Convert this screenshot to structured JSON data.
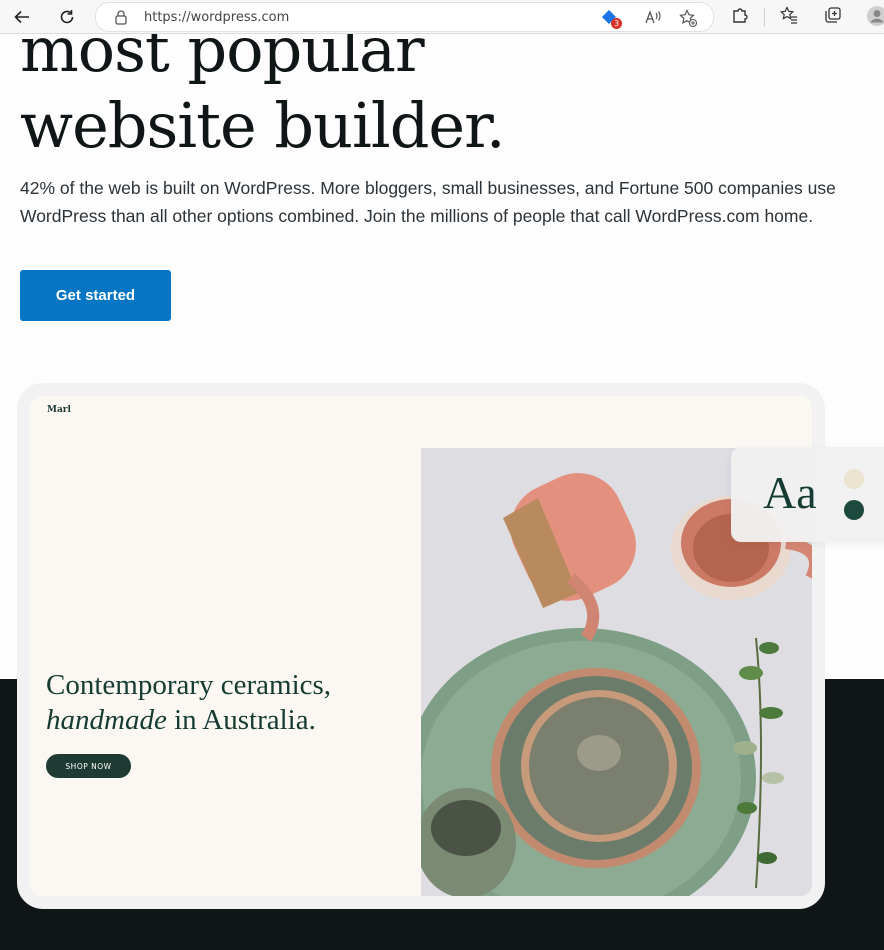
{
  "browser": {
    "url": "https://wordpress.com",
    "extension_badge_count": "3"
  },
  "hero": {
    "headline": "most popular\nwebsite builder.",
    "lead": "42% of the web is built on WordPress. More bloggers, small businesses, and Fortune 500 companies use WordPress than all other options combined. Join the millions of people that call WordPress.com home.",
    "cta_label": "Get started"
  },
  "mockup": {
    "site_name": "Marl",
    "heading_line1": "Contemporary ceramics,",
    "heading_italic": "handmade",
    "heading_rest": " in Australia.",
    "shop_button": "SHOP NOW",
    "type_sample": "Aa"
  },
  "colors": {
    "cta_blue": "#0675c4",
    "dark_band": "#101517",
    "theme_green": "#1e3a33",
    "dot_cream": "#ece3d0"
  }
}
